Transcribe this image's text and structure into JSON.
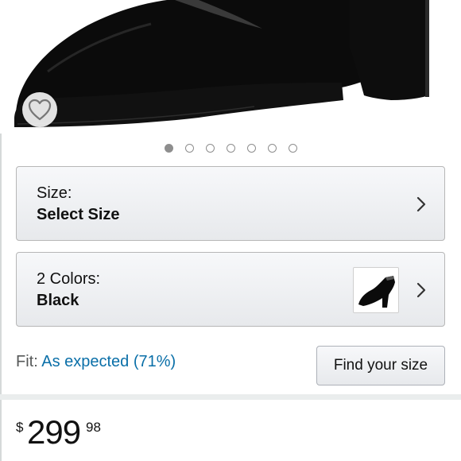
{
  "carousel": {
    "total_images": 7,
    "active_index": 0
  },
  "wishlist": {
    "icon": "heart-outline-icon"
  },
  "size_option": {
    "label": "Size:",
    "value": "Select Size"
  },
  "color_option": {
    "label": "2 Colors:",
    "value": "Black",
    "swatch": "black-pump-thumbnail"
  },
  "fit": {
    "label": "Fit:",
    "value": "As expected (71%)"
  },
  "find_size_button": {
    "label": "Find your size"
  },
  "price": {
    "currency": "$",
    "whole": "299",
    "fraction": "98"
  },
  "colors": {
    "link_blue": "#0a6fa8",
    "border": "#b7b7b7",
    "muted_text": "#565959",
    "dot": "#8e8e8e"
  }
}
